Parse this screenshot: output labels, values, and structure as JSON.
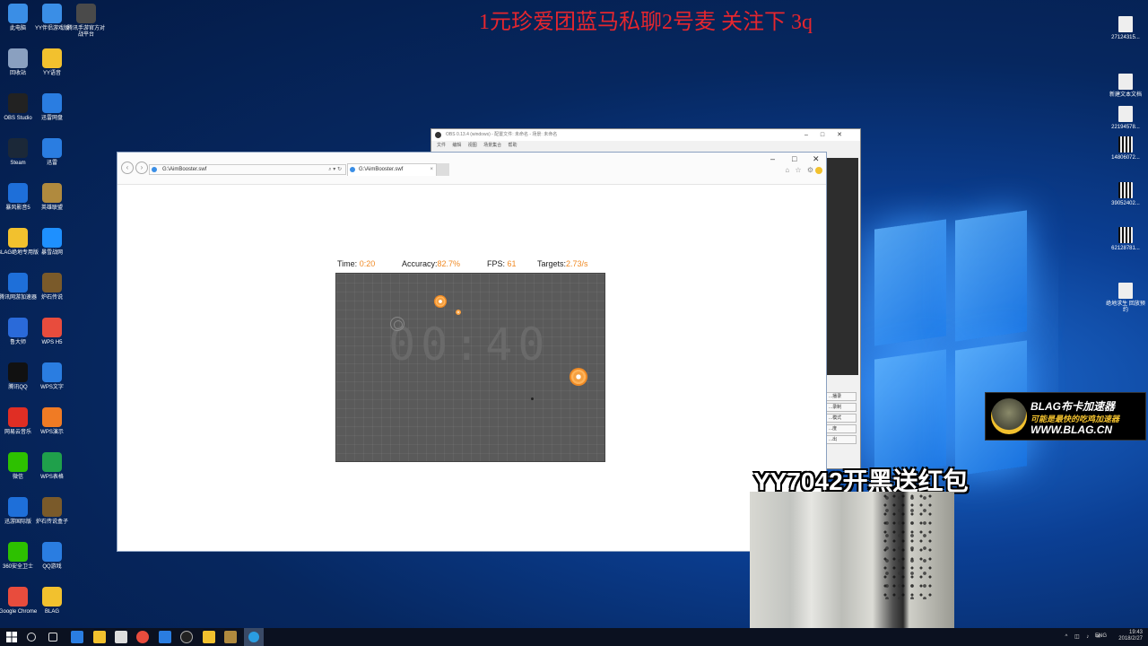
{
  "stream_banner": "1元珍爱团蓝马私聊2号麦 关注下 3q",
  "desktop": {
    "left_icons": [
      {
        "label": "此电脑",
        "icon": "computer-icon",
        "color": "#3a8ee6"
      },
      {
        "label": "YY伴侣游戏版",
        "icon": "yy-companion-icon",
        "color": "#3a8ee6"
      },
      {
        "label": "腾讯手游官方对战平台",
        "icon": "tencent-mobile-icon",
        "color": "#4a4a4a"
      },
      {
        "label": "回收站",
        "icon": "recycle-bin-icon",
        "color": "#8aa0c0"
      },
      {
        "label": "YY语音",
        "icon": "yy-voice-icon",
        "color": "#f2c12e"
      },
      {
        "label": "OBS Studio",
        "icon": "obs-icon",
        "color": "#222222"
      },
      {
        "label": "迅雷网盘",
        "icon": "xunlei-pan-icon",
        "color": "#2a7de1"
      },
      {
        "label": "Steam",
        "icon": "steam-icon",
        "color": "#1b2838"
      },
      {
        "label": "迅雷",
        "icon": "xunlei-icon",
        "color": "#2a7de1"
      },
      {
        "label": "暴风影音5",
        "icon": "baofeng-icon",
        "color": "#1e6fd9"
      },
      {
        "label": "英雄联盟",
        "icon": "lol-icon",
        "color": "#b08a3e"
      },
      {
        "label": "BLAG绝地专用版",
        "icon": "blag-icon",
        "color": "#f2c12e"
      },
      {
        "label": "暴雪战网",
        "icon": "battlenet-icon",
        "color": "#1e90ff"
      },
      {
        "label": "腾讯网游加速器",
        "icon": "tencent-accelerator-icon",
        "color": "#1e6fd9"
      },
      {
        "label": "炉石传说",
        "icon": "hearthstone-icon",
        "color": "#7a5a2a"
      },
      {
        "label": "鲁大师",
        "icon": "ludashi-icon",
        "color": "#2a6ad9"
      },
      {
        "label": "WPS H5",
        "icon": "wps-h5-icon",
        "color": "#e84c3d"
      },
      {
        "label": "腾讯QQ",
        "icon": "qq-icon",
        "color": "#111111"
      },
      {
        "label": "WPS文字",
        "icon": "wps-writer-icon",
        "color": "#2a7de1"
      },
      {
        "label": "网易云音乐",
        "icon": "netease-music-icon",
        "color": "#e02e24"
      },
      {
        "label": "WPS演示",
        "icon": "wps-presentation-icon",
        "color": "#f07b24"
      },
      {
        "label": "微信",
        "icon": "wechat-icon",
        "color": "#2dc100"
      },
      {
        "label": "WPS表格",
        "icon": "wps-spreadsheet-icon",
        "color": "#1fa04b"
      },
      {
        "label": "迅游国际版",
        "icon": "xunyou-icon",
        "color": "#1e6fd9"
      },
      {
        "label": "炉石传说盒子",
        "icon": "hearthstone-box-icon",
        "color": "#7a5a2a"
      },
      {
        "label": "360安全卫士",
        "icon": "360-security-icon",
        "color": "#2dc100"
      },
      {
        "label": "QQ游戏",
        "icon": "qq-game-icon",
        "color": "#2a7de1"
      },
      {
        "label": "Google Chrome",
        "icon": "chrome-icon",
        "color": "#e84c3d"
      },
      {
        "label": "BLAG",
        "icon": "blag-app-icon",
        "color": "#f2c12e"
      }
    ],
    "right_icons": [
      {
        "label": "27124315...",
        "icon": "file-icon"
      },
      {
        "label": "新建文本文档",
        "icon": "text-file-icon"
      },
      {
        "label": "22194578...",
        "icon": "image-file-icon"
      },
      {
        "label": "14806072...",
        "icon": "qr-file-icon"
      },
      {
        "label": "39052402...",
        "icon": "qr-file-icon"
      },
      {
        "label": "62128781...",
        "icon": "qr-file-icon"
      },
      {
        "label": "绝地求生 回放预约",
        "icon": "pubg-file-icon"
      }
    ]
  },
  "browser": {
    "address": "G:\\AimBooster.swf",
    "address_icons": "⌕ ▾ ↻",
    "tab_title": "G:\\AimBooster.swf",
    "back_glyph": "‹",
    "forward_glyph": "›",
    "minimize_glyph": "–",
    "maximize_glyph": "□",
    "close_glyph": "✕",
    "toolbar_glyphs": "⌂ ☆ ⚙"
  },
  "game": {
    "time_label": "Time:",
    "time_value": "0:20",
    "accuracy_label": "Accuracy:",
    "accuracy_value": "82.7%",
    "fps_label": "FPS:",
    "fps_value": "61",
    "targets_label": "Targets:",
    "targets_value": "2.73/s",
    "countdown": "00:40",
    "accent_color": "#f08a24"
  },
  "obs": {
    "title": "OBS 0.13.4 (windows) - 配置文件: 未命名 - 场景: 未命名",
    "menu": "文件 编辑 视图 场景集合 帮助",
    "side_buttons": [
      "...播录",
      "...录制",
      "...模式",
      "...度",
      "...出"
    ]
  },
  "overlays": {
    "blag_title": "BLAG布卡加速器",
    "blag_slogan": "可能是最快的吃鸡加速器",
    "blag_url": "WWW.BLAG.CN",
    "yy_promo": "YY7042开黑送红包"
  },
  "taskbar": {
    "lang": "ENG",
    "time": "19:43",
    "date": "2018/2/27",
    "tray_glyphs": "^ ◫ ♪ ✉"
  }
}
